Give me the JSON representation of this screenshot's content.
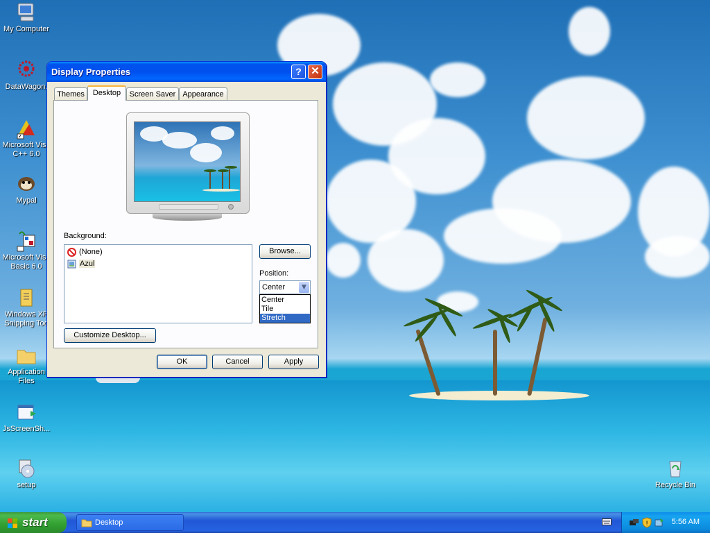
{
  "desktop": {
    "icons": [
      {
        "label": "My Computer"
      },
      {
        "label": "DataWagon."
      },
      {
        "label": "Microsoft Visu\nC++ 6.0"
      },
      {
        "label": "Mypal"
      },
      {
        "label": "Microsoft Visu\nBasic 6.0"
      },
      {
        "label": "Windows XP\nSnipping Too"
      },
      {
        "label": "Application\nFiles"
      },
      {
        "label": "JsScreenSh..."
      },
      {
        "label": "setup"
      },
      {
        "label": "Recycle Bin"
      }
    ]
  },
  "window": {
    "title": "Display Properties",
    "help_glyph": "?",
    "close_glyph": "✕",
    "tabs": [
      {
        "label": "Themes"
      },
      {
        "label": "Desktop"
      },
      {
        "label": "Screen Saver"
      },
      {
        "label": "Appearance"
      }
    ],
    "active_tab": "Desktop",
    "background_label": "Background:",
    "background_items": [
      {
        "label": "(None)",
        "icon": "none-icon"
      },
      {
        "label": "Azul",
        "icon": "image-file-icon"
      }
    ],
    "browse_label": "Browse...",
    "position_label": "Position:",
    "position_value": "Center",
    "position_options": [
      "Center",
      "Tile",
      "Stretch"
    ],
    "position_highlighted": "Stretch",
    "customize_label": "Customize Desktop...",
    "ok_label": "OK",
    "cancel_label": "Cancel",
    "apply_label": "Apply"
  },
  "taskbar": {
    "start_label": "start",
    "task_label": "Desktop",
    "clock": "5:56 AM"
  },
  "colors": {
    "title_blue": "#0053ee",
    "selection": "#316ac5",
    "tab_accent": "#f7b33d",
    "start_green": "#31a031"
  }
}
